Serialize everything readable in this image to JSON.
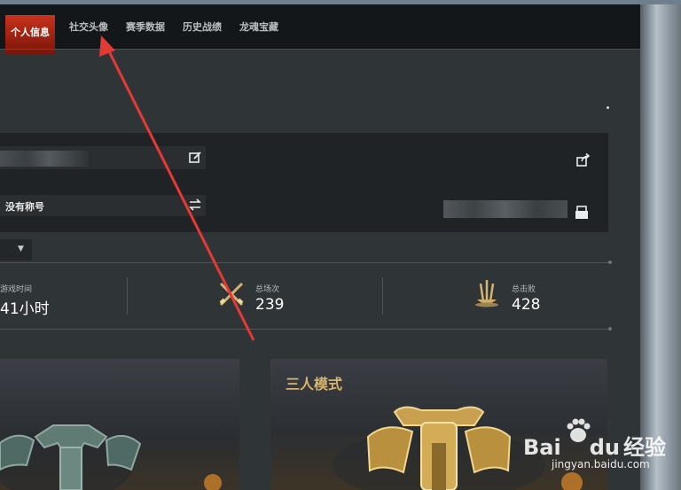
{
  "nav": {
    "tabs": [
      {
        "label": "个人信息",
        "active": true
      },
      {
        "label": "社交头像"
      },
      {
        "label": "赛季数据"
      },
      {
        "label": "历史战绩"
      },
      {
        "label": "龙魂宝藏"
      }
    ]
  },
  "profile": {
    "title_label": "没有称号",
    "icons": {
      "edit": "edit-icon",
      "swap": "swap-icon",
      "share": "share-icon",
      "copy": "copy-icon"
    }
  },
  "stats": [
    {
      "label": "游戏时间",
      "value": "41小时",
      "icon": "clock-icon"
    },
    {
      "label": "总场次",
      "value": "239",
      "icon": "crossed-swords-icon"
    },
    {
      "label": "总击败",
      "value": "428",
      "icon": "trophy-swords-icon"
    }
  ],
  "modes": {
    "right_title": "三人模式"
  },
  "watermark": {
    "brand_left": "Bai",
    "brand_mid": "du",
    "brand_cn": "经验",
    "url": "jingyan.baidu.com"
  },
  "colors": {
    "active_tab": "#c8321c",
    "accent_gold": "#d9b56c",
    "annotation_arrow": "#e53935"
  }
}
